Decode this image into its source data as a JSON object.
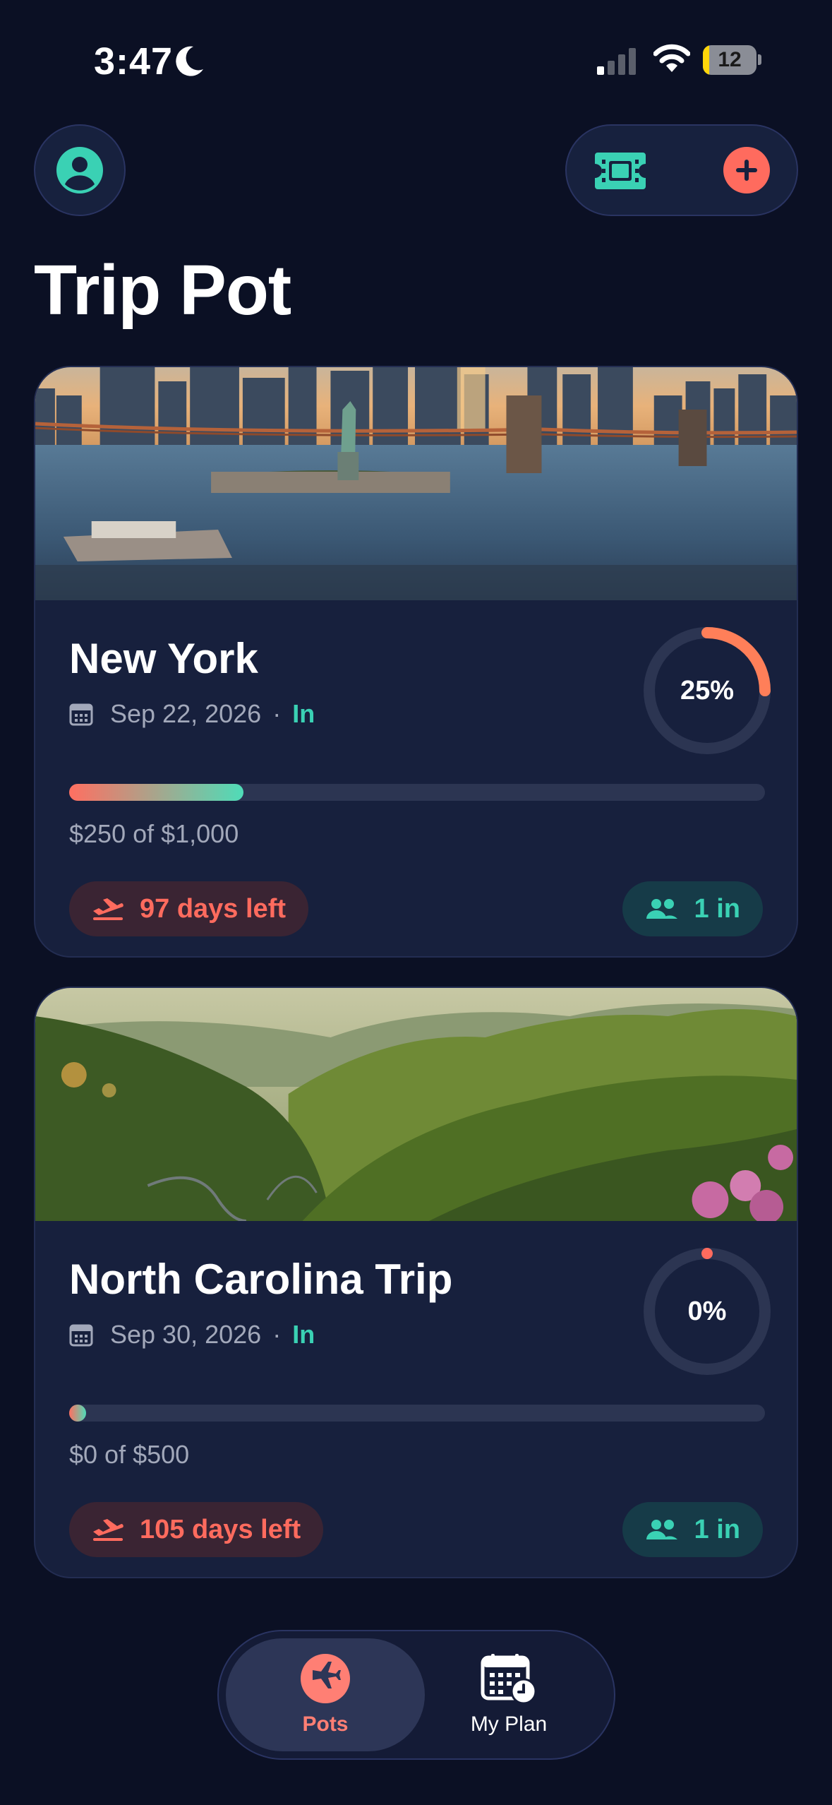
{
  "status_bar": {
    "time": "3:47",
    "battery": "12",
    "battery_level": 0.12
  },
  "header": {
    "title": "Trip Pot"
  },
  "trips": [
    {
      "name": "New York",
      "date": "Sep 22, 2026",
      "separator": "·",
      "status": "In",
      "percent_label": "25%",
      "progress": 0.25,
      "amount_text": "$250 of $1,000",
      "days_left": "97 days left",
      "members": "1 in"
    },
    {
      "name": "North Carolina Trip",
      "date": "Sep 30, 2026",
      "separator": "·",
      "status": "In",
      "percent_label": "0%",
      "progress": 0,
      "amount_text": "$0 of $500",
      "days_left": "105 days left",
      "members": "1 in"
    }
  ],
  "tab_bar": {
    "pots": "Pots",
    "my_plan": "My Plan"
  },
  "colors": {
    "accent_coral": "#ff6b5e",
    "accent_teal": "#3ad1b4",
    "background": "#0b1024",
    "card": "#17203d"
  },
  "icons": [
    "moon-icon",
    "signal-icon",
    "wifi-icon",
    "battery-icon",
    "profile-icon",
    "ticket-icon",
    "plus-icon",
    "calendar-icon",
    "plane-icon",
    "people-icon",
    "calendar-clock-icon"
  ]
}
